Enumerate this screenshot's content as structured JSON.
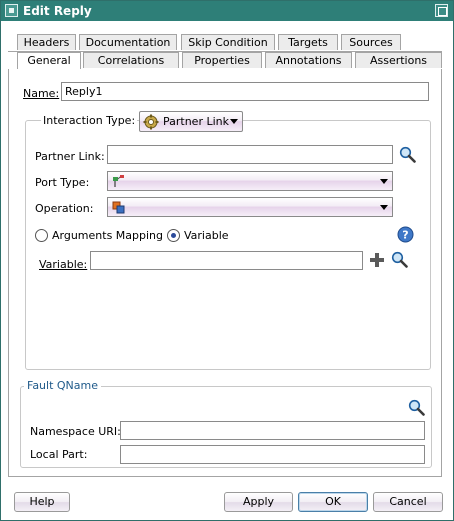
{
  "window": {
    "title": "Edit Reply"
  },
  "tabs": {
    "row1": [
      "Headers",
      "Documentation",
      "Skip Condition",
      "Targets",
      "Sources"
    ],
    "row2": [
      "General",
      "Correlations",
      "Properties",
      "Annotations",
      "Assertions"
    ],
    "active": "General"
  },
  "general": {
    "name_label": "Name:",
    "name_value": "Reply1",
    "interaction_type_label": "Interaction Type:",
    "interaction_type_value": "Partner Link",
    "partner_link_label": "Partner Link:",
    "partner_link_value": "",
    "port_type_label": "Port Type:",
    "port_type_value": "",
    "operation_label": "Operation:",
    "operation_value": "",
    "radio_arguments_label": "Arguments Mapping",
    "radio_variable_label": "Variable",
    "radio_selected": "Variable",
    "variable_label": "Variable:",
    "variable_value": "",
    "fault_group_title": "Fault QName",
    "namespace_uri_label": "Namespace URI:",
    "namespace_uri_value": "",
    "local_part_label": "Local Part:",
    "local_part_value": ""
  },
  "buttons": {
    "help": "Help",
    "apply": "Apply",
    "ok": "OK",
    "cancel": "Cancel"
  },
  "icons": {
    "search": "magnifier-icon",
    "add": "plus-icon",
    "help": "help-circle-icon"
  },
  "colors": {
    "titlebar": "#2e7f78",
    "group_title": "#1f5a8a"
  }
}
